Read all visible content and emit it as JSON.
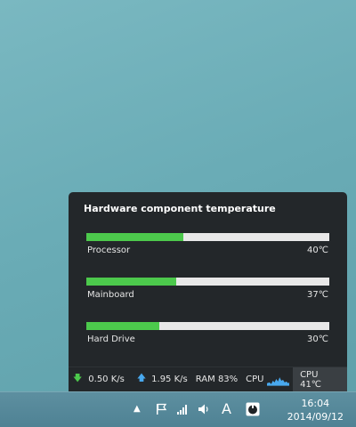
{
  "popup": {
    "title": "Hardware component temperature",
    "sensors": [
      {
        "name": "Processor",
        "temp": "40℃",
        "level": 0.4
      },
      {
        "name": "Mainboard",
        "temp": "37℃",
        "level": 0.37
      },
      {
        "name": "Hard Drive",
        "temp": "30℃",
        "level": 0.3
      }
    ]
  },
  "strip": {
    "download": "0.50 K/s",
    "upload": "1.95 K/s",
    "ram": "RAM 83%",
    "cpu_label": "CPU",
    "cpu_temp": "CPU 41℃"
  },
  "taskbar": {
    "ime": "A",
    "time": "16:04",
    "date": "2014/09/12"
  },
  "colors": {
    "bar_fill": "#4cc94c",
    "bar_track": "#e8e8e8",
    "panel": "#23272a",
    "download_arrow": "#4cc94c",
    "upload_arrow": "#48a8ee",
    "cpu_graph": "#48a8ee"
  },
  "icons": [
    "chevron-up-icon",
    "flag-icon",
    "signal-icon",
    "speaker-icon",
    "app-tray-icon",
    "download-arrow-icon",
    "upload-arrow-icon"
  ]
}
